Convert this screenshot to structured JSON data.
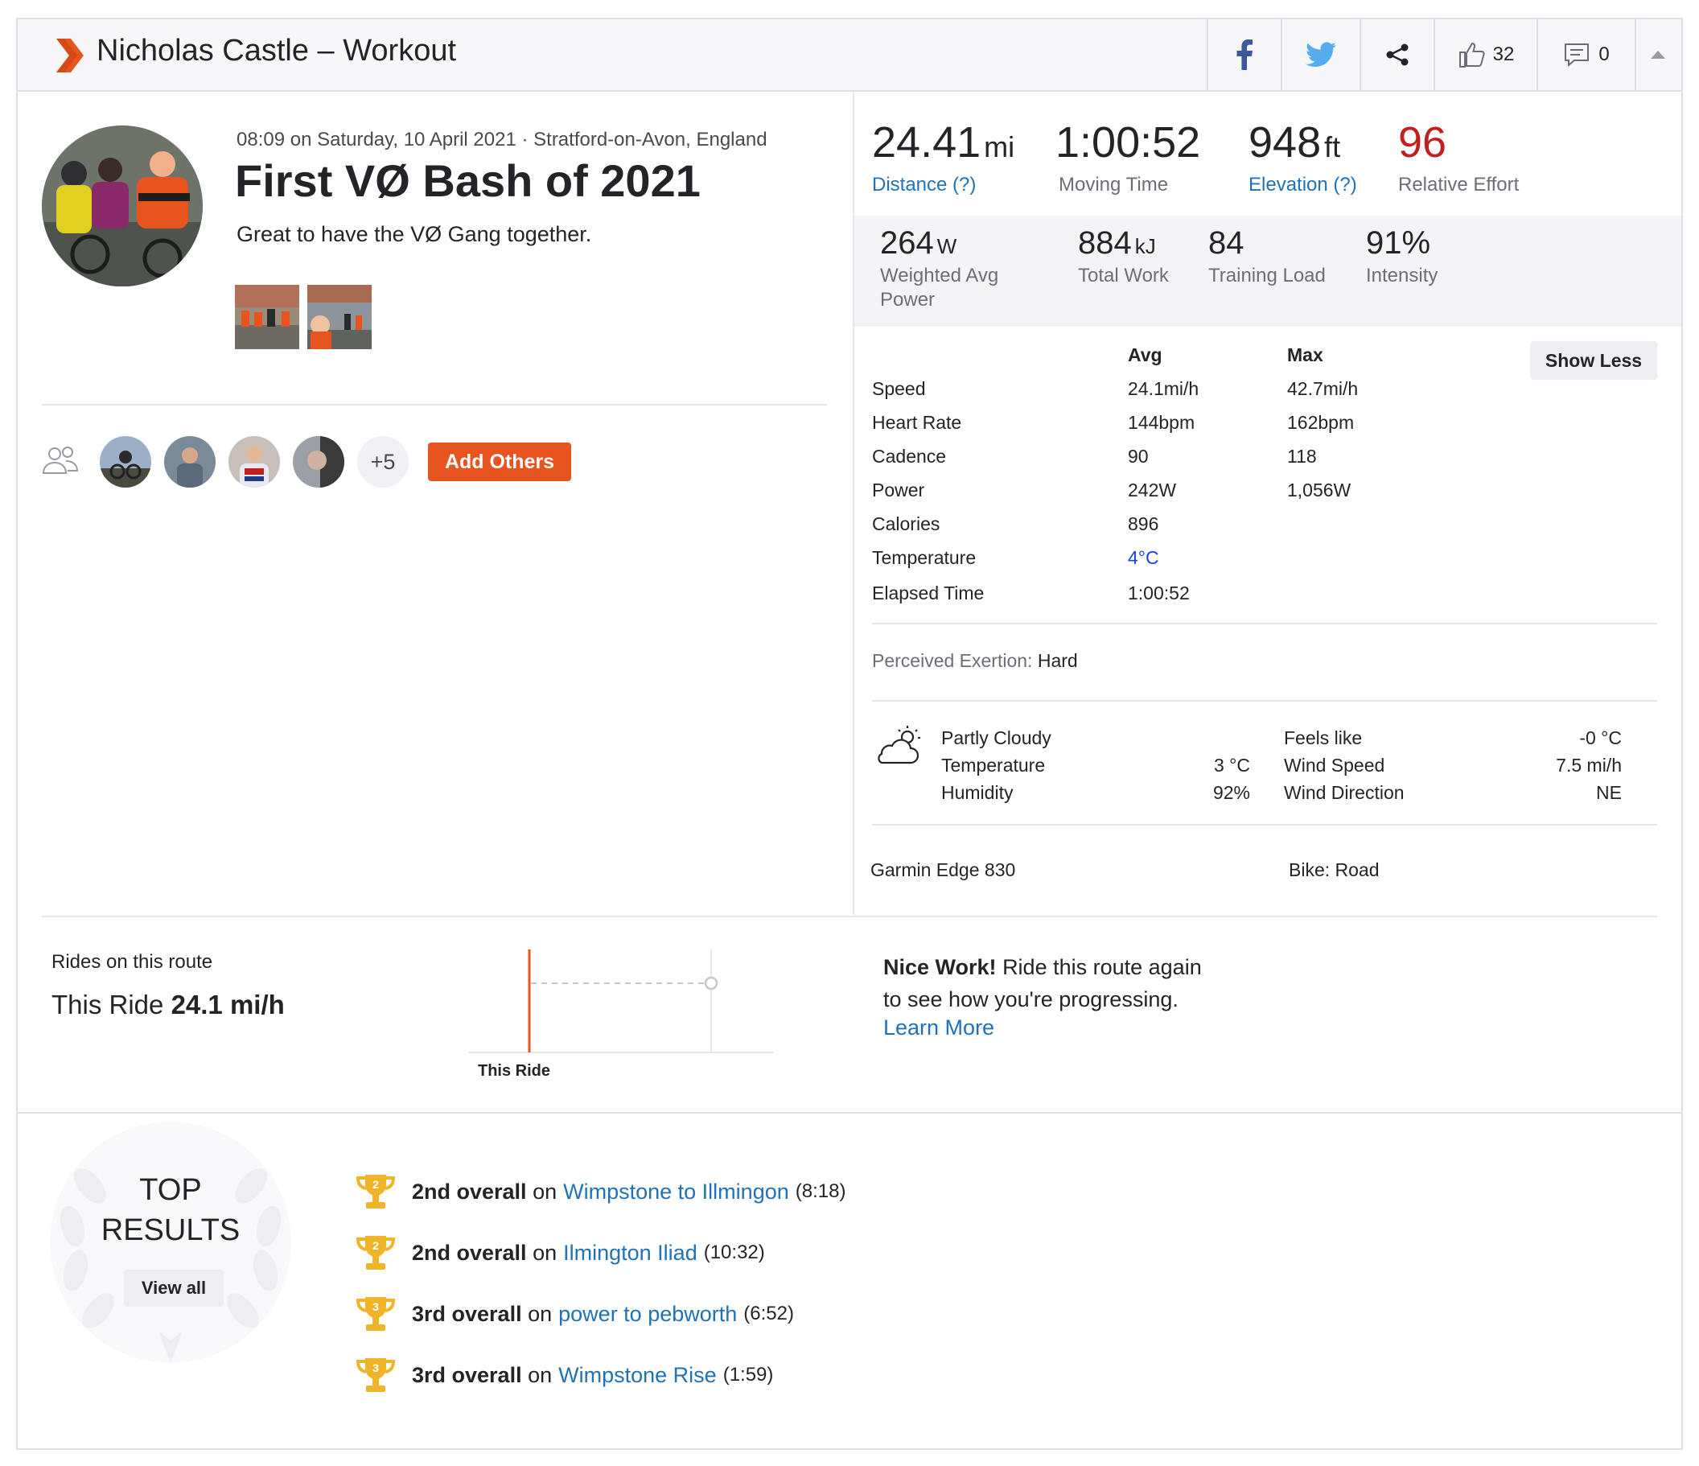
{
  "header": {
    "title": "Nicholas Castle – Workout",
    "kudos_count": "32",
    "comment_count": "0"
  },
  "activity": {
    "meta": "08:09 on Saturday, 10 April 2021 · Stratford-on-Avon, England",
    "title": "First VØ Bash of 2021",
    "description": "Great to have the VØ Gang together.",
    "more_athletes": "+5",
    "add_others": "Add Others"
  },
  "primary_stats": [
    {
      "value": "24.41",
      "unit": "mi",
      "label": "Distance (?)"
    },
    {
      "value": "1:00:52",
      "unit": "",
      "label": "Moving Time"
    },
    {
      "value": "948",
      "unit": "ft",
      "label": "Elevation (?)"
    },
    {
      "value": "96",
      "unit": "",
      "label": "Relative Effort"
    }
  ],
  "secondary_stats": [
    {
      "value": "264",
      "unit": "W",
      "label": "Weighted Avg Power"
    },
    {
      "value": "884",
      "unit": "kJ",
      "label": "Total Work"
    },
    {
      "value": "84",
      "unit": "",
      "label": "Training Load"
    },
    {
      "value": "91%",
      "unit": "",
      "label": "Intensity"
    }
  ],
  "more_stats": {
    "avg_header": "Avg",
    "max_header": "Max",
    "show_less": "Show Less",
    "rows": [
      {
        "label": "Speed",
        "avg": "24.1mi/h",
        "max": "42.7mi/h"
      },
      {
        "label": "Heart Rate",
        "avg": "144bpm",
        "max": "162bpm"
      },
      {
        "label": "Cadence",
        "avg": "90",
        "max": "118"
      },
      {
        "label": "Power",
        "avg": "242W",
        "max": "1,056W"
      },
      {
        "label": "Calories",
        "avg": "896",
        "max": ""
      },
      {
        "label": "Temperature",
        "avg": "4°C",
        "max": ""
      },
      {
        "label": "Elapsed Time",
        "avg": "1:00:52",
        "max": ""
      }
    ]
  },
  "perceived": {
    "label": "Perceived Exertion:",
    "value": "Hard"
  },
  "weather": {
    "condition": "Partly Cloudy",
    "temperature_label": "Temperature",
    "temperature": "3 °C",
    "humidity_label": "Humidity",
    "humidity": "92%",
    "feels_like_label": "Feels like",
    "feels_like": "-0 °C",
    "wind_speed_label": "Wind Speed",
    "wind_speed": "7.5 mi/h",
    "wind_direction_label": "Wind Direction",
    "wind_direction": "NE"
  },
  "device": {
    "name": "Garmin Edge 830",
    "bike": "Bike: Road"
  },
  "route": {
    "heading": "Rides on this route",
    "this_ride_label": "This Ride",
    "this_ride_speed": "24.1 mi/h",
    "chart_label": "This Ride",
    "nice_bold": "Nice Work!",
    "nice_line1": "Ride this route again",
    "nice_line2": "to see how you're progressing.",
    "learn_more": "Learn More"
  },
  "top_results": {
    "title_line1": "TOP",
    "title_line2": "RESULTS",
    "view_all": "View all",
    "items": [
      {
        "rank_num": "2",
        "rank": "2nd overall",
        "on": "on",
        "segment": "Wimpstone to Illmingon",
        "time": "(8:18)"
      },
      {
        "rank_num": "2",
        "rank": "2nd overall",
        "on": "on",
        "segment": "Ilmington Iliad",
        "time": "(10:32)"
      },
      {
        "rank_num": "3",
        "rank": "3rd overall",
        "on": "on",
        "segment": "power to pebworth",
        "time": "(6:52)"
      },
      {
        "rank_num": "3",
        "rank": "3rd overall",
        "on": "on",
        "segment": "Wimpstone Rise",
        "time": "(1:59)"
      }
    ]
  },
  "colors": {
    "brand": "#e8541f",
    "link": "#1f72b8",
    "effort": "#c0201e",
    "trophy": "#f0b429"
  }
}
